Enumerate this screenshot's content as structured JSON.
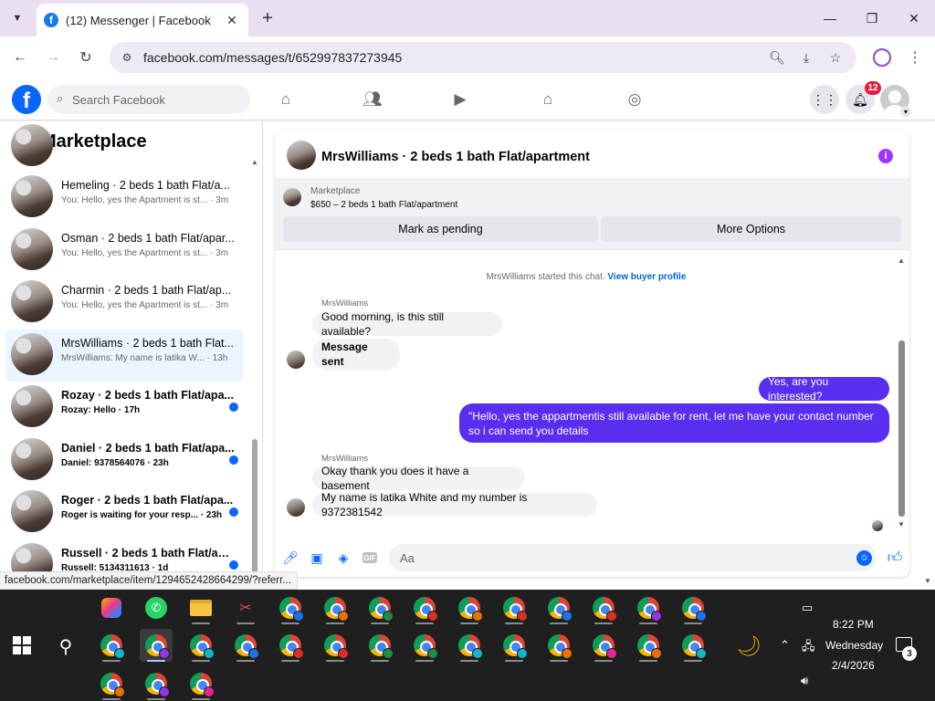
{
  "browser": {
    "tab_title": "(12) Messenger | Facebook",
    "url": "facebook.com/messages/t/652997837273945",
    "status_url": "facebook.com/marketplace/item/1294652428664299/?referr..."
  },
  "facebook": {
    "search_placeholder": "Search Facebook",
    "notification_count": "12"
  },
  "sidebar": {
    "title": "Marketplace",
    "conversations": [
      {
        "name": "Hemeling · 2 beds 1 bath Flat/a...",
        "preview": "You: Hello, yes the Apartment is st... · 3m",
        "unread": false
      },
      {
        "name": "Osman · 2 beds 1 bath Flat/apar...",
        "preview": "You: Hello, yes the Apartment is st... · 3m",
        "unread": false
      },
      {
        "name": "Charmin · 2 beds 1 bath Flat/ap...",
        "preview": "You: Hello, yes the Apartment is st... · 3m",
        "unread": false
      },
      {
        "name": "MrsWilliams · 2 beds 1 bath Flat...",
        "preview": "MrsWilliams: My name is latika W... · 13h",
        "unread": false
      },
      {
        "name": "Rozay · 2 beds 1 bath Flat/apa...",
        "preview": "Rozay: Hello · 17h",
        "unread": true
      },
      {
        "name": "Daniel · 2 beds 1 bath Flat/apa...",
        "preview": "Daniel: 9378564076 · 23h",
        "unread": true
      },
      {
        "name": "Roger · 2 beds 1 bath Flat/apa...",
        "preview": "Roger is waiting for your resp... · 23h",
        "unread": true
      },
      {
        "name": "Russell · 2 beds 1 bath Flat/apa...",
        "preview": "Russell: 5134311613 · 1d",
        "unread": true
      }
    ]
  },
  "chat": {
    "title": "MrsWilliams · 2 beds 1 bath Flat/apartment",
    "listing_label": "Marketplace",
    "listing_price": "$650 – 2 beds 1 bath Flat/apartment",
    "mark_pending": "Mark as pending",
    "more_options": "More Options",
    "started_text": "MrsWilliams started this chat.",
    "view_buyer": "View buyer profile",
    "sender": "MrsWilliams",
    "messages": [
      {
        "text": "Good morning, is this still available?"
      },
      {
        "text": "Message sent"
      },
      {
        "text": "Yes, are you interested?"
      },
      {
        "text": "\"Hello, yes the appartmentis still available for rent, let me have your contact number so i can send you details"
      },
      {
        "text": "Okay thank you does it have a basement"
      },
      {
        "text": "My name is latika White and my number is 9372381542"
      }
    ],
    "composer_placeholder": "Aa"
  },
  "taskbar": {
    "time": "8:22 PM",
    "day": "Wednesday",
    "date": "2/4/2026",
    "notification_count": "3"
  }
}
